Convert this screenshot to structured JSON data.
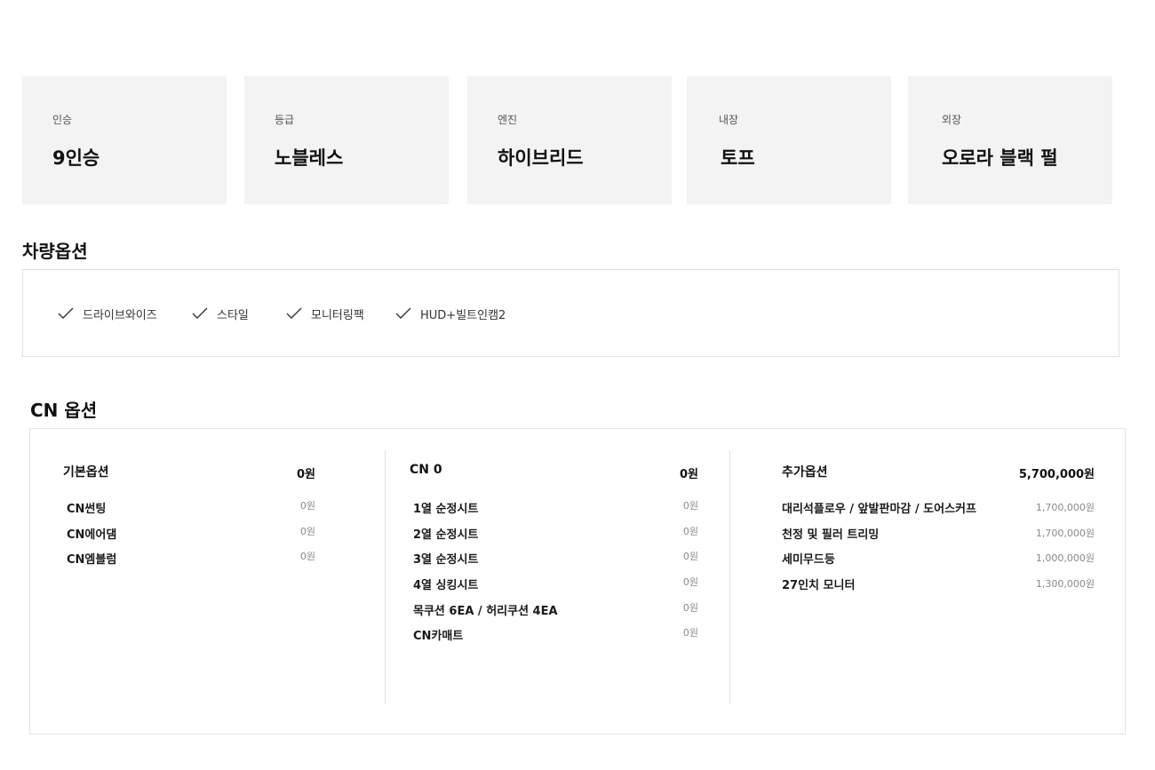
{
  "specs": [
    {
      "label": "인승",
      "value": "9인승"
    },
    {
      "label": "등급",
      "value": "노블레스"
    },
    {
      "label": "엔진",
      "value": "하이브리드"
    },
    {
      "label": "내장",
      "value": "토프"
    },
    {
      "label": "외장",
      "value": "오로라 블랙 펄"
    }
  ],
  "vehicle_options": {
    "title": "차량옵션",
    "items": [
      "드라이브와이즈",
      "스타일",
      "모니터링팩",
      "HUD+빌트인캠2"
    ]
  },
  "cn_options": {
    "title": "CN 옵션",
    "columns": [
      {
        "header": "기본옵션",
        "header_price": "0원",
        "rows": [
          {
            "name": "CN썬팅",
            "price": "0원"
          },
          {
            "name": "CN에어댐",
            "price": "0원"
          },
          {
            "name": "CN엠블럼",
            "price": "0원"
          }
        ]
      },
      {
        "header": "CN 0",
        "header_price": "0원",
        "rows": [
          {
            "name": "1열 순정시트",
            "price": "0원"
          },
          {
            "name": "2열 순정시트",
            "price": "0원"
          },
          {
            "name": "3열 순정시트",
            "price": "0원"
          },
          {
            "name": "4열 싱킹시트",
            "price": "0원"
          },
          {
            "name": "목쿠션 6EA / 허리쿠션 4EA",
            "price": "0원"
          },
          {
            "name": "CN카매트",
            "price": "0원"
          }
        ]
      },
      {
        "header": "추가옵션",
        "header_price": "5,700,000원",
        "rows": [
          {
            "name": "대리석플로우 / 앞발판마감 / 도어스커프",
            "price": "1,700,000원"
          },
          {
            "name": "천정 및 필러 트리밍",
            "price": "1,700,000원"
          },
          {
            "name": "세미무드등",
            "price": "1,000,000원"
          },
          {
            "name": "27인치 모니터",
            "price": "1,300,000원"
          }
        ]
      }
    ]
  },
  "icons": {
    "check": "check-icon"
  }
}
